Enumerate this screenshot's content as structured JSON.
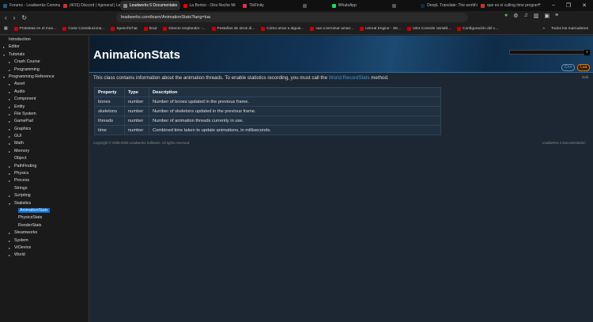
{
  "browser": {
    "tabs": [
      {
        "title": "Forums - Leadwerks Communit",
        "color": "#2a5a7a"
      },
      {
        "title": "(4/15) Discord | #general | Leadw",
        "color": "#d03030"
      },
      {
        "title": "Leadwerks 5 Documentatio",
        "color": "#888",
        "active": true
      },
      {
        "title": "La Bertso - Otra Noche Mi",
        "color": "#e00"
      },
      {
        "title": "TikFinity",
        "color": "#e03050"
      },
      {
        "title": "",
        "color": "#555"
      },
      {
        "title": "WhatsApp",
        "color": "#25d366"
      },
      {
        "title": "",
        "color": "#555"
      },
      {
        "title": "DeepL Translate: The world's m",
        "color": "#0f2b46"
      },
      {
        "title": "que es el culling time program",
        "color": "#c33"
      }
    ],
    "url": "leadwerks.com/learn/AnimationStats?lang=lua",
    "bookmarks": [
      "Protestas en el mun...",
      "Corte Constituciona...",
      "SpeechChat",
      "brad",
      "Directo resplandor -...",
      "Pestañas de otros di...",
      "Cómo amar a alguie...",
      "vas a terminar aman...",
      "Unreal Engine - 3D...",
      "UE4 Console Variabl...",
      "Configuración del c..."
    ],
    "bookmarks_overflow": "»",
    "all_bookmarks": "Todos los marcadores"
  },
  "sidebar": {
    "items": [
      {
        "label": "Introduction",
        "level": 0,
        "arrow": ""
      },
      {
        "label": "Editor",
        "level": 0,
        "arrow": "▸"
      },
      {
        "label": "Tutorials",
        "level": 0,
        "arrow": "▾"
      },
      {
        "label": "Crash Course",
        "level": 1,
        "arrow": "▸"
      },
      {
        "label": "Programming",
        "level": 1,
        "arrow": "▸"
      },
      {
        "label": "Programming Reference",
        "level": 0,
        "arrow": "▾"
      },
      {
        "label": "Asset",
        "level": 1,
        "arrow": "▸"
      },
      {
        "label": "Audio",
        "level": 1,
        "arrow": "▸"
      },
      {
        "label": "Component",
        "level": 1,
        "arrow": "▸"
      },
      {
        "label": "Entity",
        "level": 1,
        "arrow": "▸"
      },
      {
        "label": "File System",
        "level": 1,
        "arrow": "▸"
      },
      {
        "label": "GamePad",
        "level": 1,
        "arrow": "▸"
      },
      {
        "label": "Graphics",
        "level": 1,
        "arrow": "▸"
      },
      {
        "label": "GUI",
        "level": 1,
        "arrow": "▸"
      },
      {
        "label": "Math",
        "level": 1,
        "arrow": "▸"
      },
      {
        "label": "Memory",
        "level": 1,
        "arrow": "▸"
      },
      {
        "label": "Object",
        "level": 1,
        "arrow": ""
      },
      {
        "label": "PathFinding",
        "level": 1,
        "arrow": "▸"
      },
      {
        "label": "Physics",
        "level": 1,
        "arrow": "▸"
      },
      {
        "label": "Process",
        "level": 1,
        "arrow": "▸"
      },
      {
        "label": "Strings",
        "level": 1,
        "arrow": ""
      },
      {
        "label": "Scripting",
        "level": 1,
        "arrow": "▸"
      },
      {
        "label": "Statistics",
        "level": 1,
        "arrow": "▾"
      },
      {
        "label": "AnimationStats",
        "level": 2,
        "arrow": "",
        "selected": true
      },
      {
        "label": "PhysicsStats",
        "level": 2,
        "arrow": ""
      },
      {
        "label": "RenderStats",
        "level": 2,
        "arrow": ""
      },
      {
        "label": "Steamworks",
        "level": 1,
        "arrow": "▸"
      },
      {
        "label": "System",
        "level": 1,
        "arrow": "▸"
      },
      {
        "label": "VrDevice",
        "level": 1,
        "arrow": "▸"
      },
      {
        "label": "World",
        "level": 1,
        "arrow": "▸"
      }
    ]
  },
  "page": {
    "title": "AnimationStats",
    "lang_cpp": "C++",
    "lang_lua": "Lua",
    "edit": "Edit",
    "desc_prefix": "This class contains information about the animation threads. To enable statistics recording, you must call the ",
    "desc_link": "World:RecordStats",
    "desc_suffix": " method.",
    "table": {
      "headers": [
        "Property",
        "Type",
        "Description"
      ],
      "rows": [
        [
          "bones",
          "number",
          "Number of bones updated in the previous frame."
        ],
        [
          "skeletons",
          "number",
          "Number of skeletons updated in the previous frame."
        ],
        [
          "threads",
          "number",
          "Number of animation threads currently in use."
        ],
        [
          "time",
          "number",
          "Combined time taken to update animations, in milliseconds."
        ]
      ]
    },
    "copyright": "Copyright © 2006-2025 Leadwerks Software. All rights reserved.",
    "doc_version": "Leadwerks 4 Documentation"
  },
  "colors": {
    "accent": "#0a6ed1",
    "lua": "#e07a10",
    "link": "#3a9ae6"
  }
}
